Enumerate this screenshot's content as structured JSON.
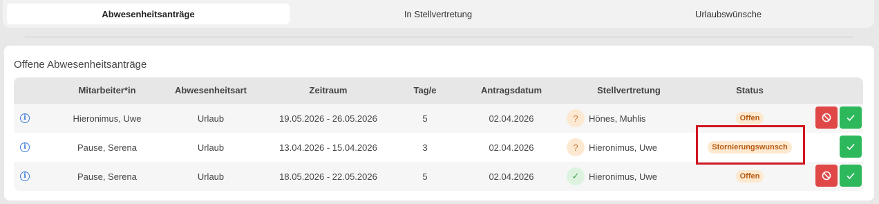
{
  "tabs": [
    {
      "label": "Abwesenheitsanträge",
      "active": true
    },
    {
      "label": "In Stellvertretung",
      "active": false
    },
    {
      "label": "Urlaubswünsche",
      "active": false
    }
  ],
  "card": {
    "title": "Offene Abwesenheitsanträge"
  },
  "table": {
    "headers": {
      "mitarbeiter": "Mitarbeiter*in",
      "art": "Abwesenheitsart",
      "zeitraum": "Zeitraum",
      "tage": "Tag/e",
      "antragsdatum": "Antragsdatum",
      "stellvertretung": "Stellvertretung",
      "status": "Status"
    },
    "rows": [
      {
        "mitarbeiter": "Hieronimus, Uwe",
        "art": "Urlaub",
        "zeitraum": "19.05.2026 - 26.05.2026",
        "tage": "5",
        "antragsdatum": "02.04.2026",
        "sv_icon": "?",
        "sv_state": "question-icon",
        "stellvertretung": "Hönes, Muhlis",
        "status": "Offen",
        "actions": [
          "reject",
          "approve"
        ]
      },
      {
        "mitarbeiter": "Pause, Serena",
        "art": "Urlaub",
        "zeitraum": "13.04.2026 - 15.04.2026",
        "tage": "3",
        "antragsdatum": "02.04.2026",
        "sv_icon": "?",
        "sv_state": "question-icon",
        "stellvertretung": "Hieronimus, Uwe",
        "status": "Stornierungswunsch",
        "actions": [
          "approve"
        ]
      },
      {
        "mitarbeiter": "Pause, Serena",
        "art": "Urlaub",
        "zeitraum": "18.05.2026 - 22.05.2026",
        "tage": "5",
        "antragsdatum": "02.04.2026",
        "sv_icon": "✓",
        "sv_state": "check-icon",
        "stellvertretung": "Hieronimus, Uwe",
        "status": "Offen",
        "actions": [
          "reject",
          "approve"
        ]
      }
    ]
  },
  "colors": {
    "reject": "#e04848",
    "approve": "#2eb85c",
    "status_badge_bg": "#fde9d0",
    "status_badge_text": "#b75a10",
    "highlight": "#d0161f",
    "info": "#3b7dd8"
  },
  "icons": {
    "info": "info-icon",
    "reject": "ban-icon",
    "approve": "check-icon"
  }
}
